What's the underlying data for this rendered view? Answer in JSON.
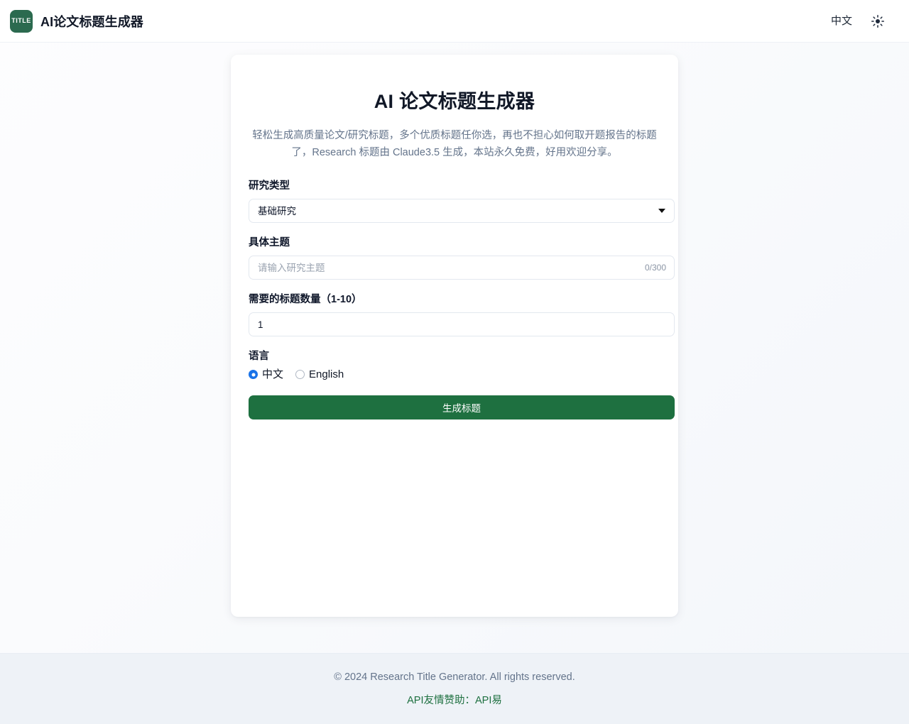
{
  "header": {
    "logo_text": "TITLE",
    "logo_color": "#2b6a4f",
    "brand_title": "AI论文标题生成器",
    "lang_switch": "中文",
    "theme_icon": "sun-icon"
  },
  "card": {
    "title": "AI 论文标题生成器",
    "description": "轻松生成高质量论文/研究标题，多个优质标题任你选，再也不担心如何取开题报告的标题了，Research 标题由 Claude3.5 生成，本站永久免费，好用欢迎分享。"
  },
  "form": {
    "research_type": {
      "label": "研究类型",
      "value": "基础研究",
      "options": [
        "基础研究"
      ]
    },
    "topic": {
      "label": "具体主题",
      "value": "",
      "placeholder": "请输入研究主题",
      "counter": "0/300"
    },
    "count": {
      "label": "需要的标题数量（1-10）",
      "value": "1"
    },
    "language": {
      "label": "语言",
      "options": [
        {
          "label": "中文",
          "checked": true
        },
        {
          "label": "English",
          "checked": false
        }
      ]
    },
    "submit_label": "生成标题",
    "submit_color": "#1e7040"
  },
  "footer": {
    "copyright": "© 2024 Research Title Generator. All rights reserved.",
    "sponsor_link": "API友情赞助：API易",
    "link_color": "#1e7040"
  }
}
